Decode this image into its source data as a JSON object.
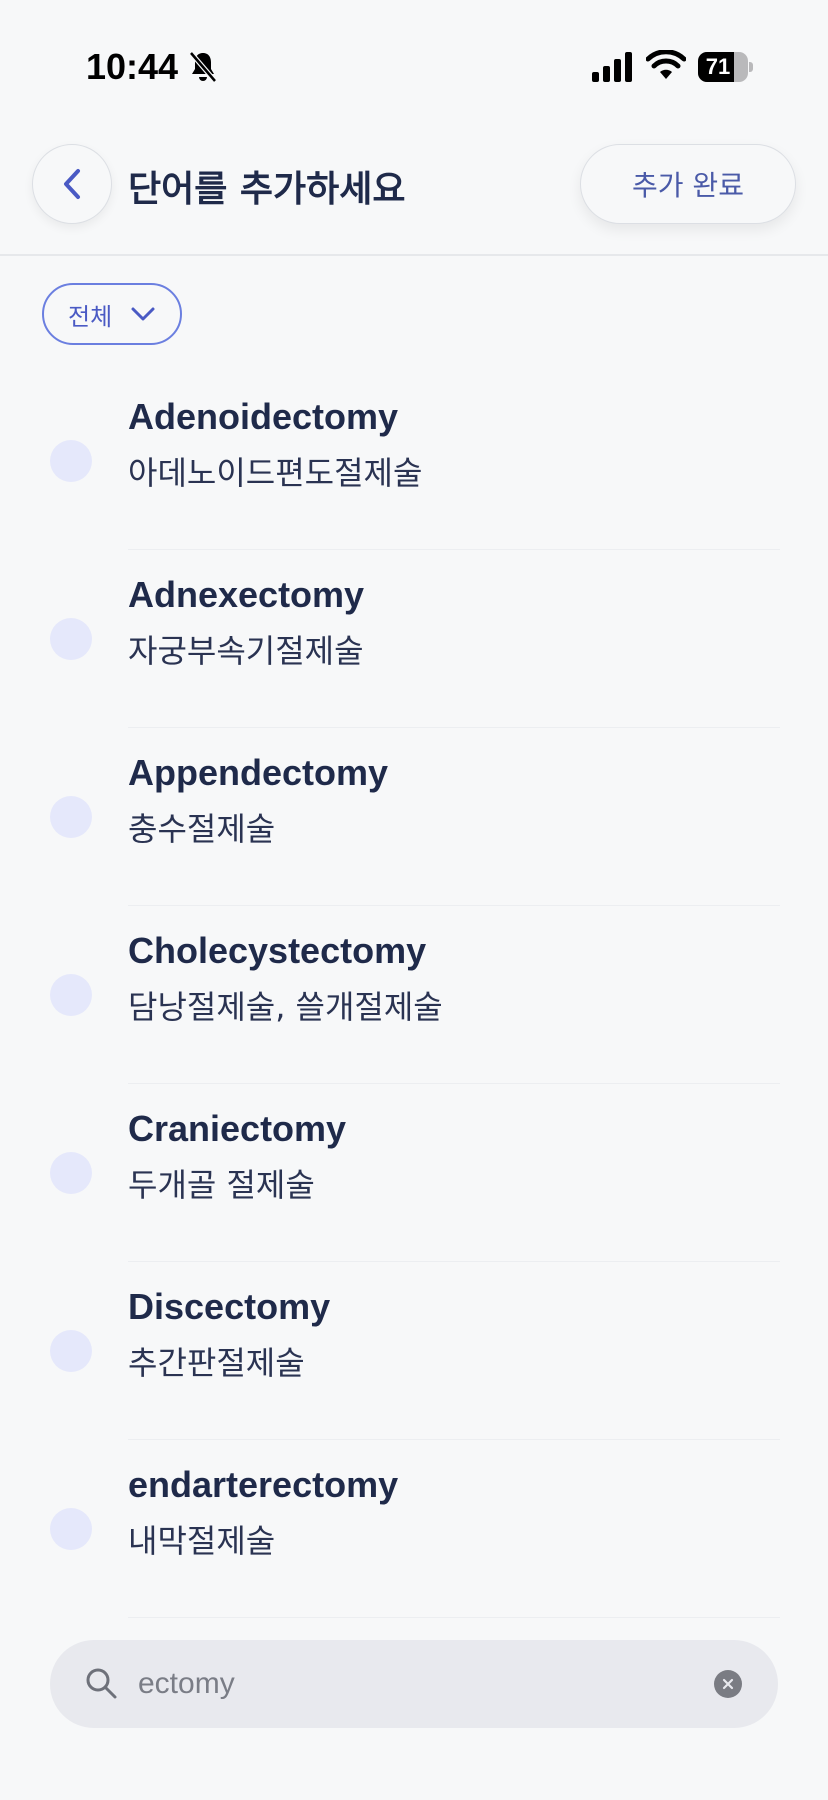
{
  "status_bar": {
    "time": "10:44",
    "battery": "71",
    "battery_level": 0.71
  },
  "header": {
    "title": "단어를 추가하세요",
    "done_label": "추가 완료"
  },
  "filter": {
    "label": "전체"
  },
  "words": [
    {
      "en": "Adenoidectomy",
      "ko": "아데노이드편도절제술"
    },
    {
      "en": "Adnexectomy",
      "ko": "자궁부속기절제술"
    },
    {
      "en": "Appendectomy",
      "ko": "충수절제술"
    },
    {
      "en": "Cholecystectomy",
      "ko": "담낭절제술, 쓸개절제술"
    },
    {
      "en": "Craniectomy",
      "ko": "두개골 절제술"
    },
    {
      "en": "Discectomy",
      "ko": "추간판절제술"
    },
    {
      "en": "endarterectomy",
      "ko": "내막절제술"
    }
  ],
  "search": {
    "value": "ectomy"
  },
  "colors": {
    "background": "#f7f8f9",
    "accent": "#4a5ac4",
    "text_primary": "#1f2a4a",
    "circle": "#e5e8fb"
  }
}
